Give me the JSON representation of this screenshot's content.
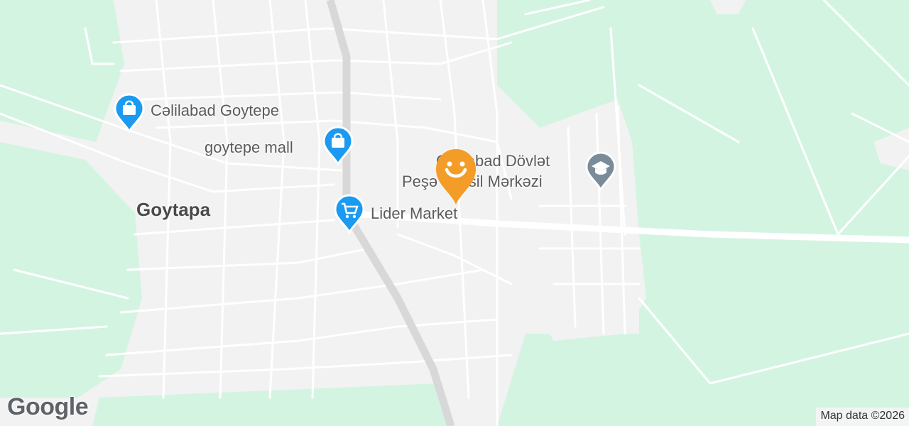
{
  "map": {
    "colors": {
      "land": "#f2f2f2",
      "vegetation": "#d4f4e2",
      "road_minor": "#ffffff",
      "road_highway": "#d8d8d8",
      "poi_shopping": "#1a9af0",
      "poi_education": "#7a8b99",
      "marker": "#f39c27"
    },
    "city_label": "Goytapa",
    "pois": [
      {
        "label": "Cəlilabad Goytepe",
        "icon": "shopping-bag-icon"
      },
      {
        "label": "goytepe mall",
        "icon": "shopping-bag-icon"
      },
      {
        "label": "Lider Market",
        "icon": "shopping-cart-icon"
      },
      {
        "label": "Cəlilabad Dövlət",
        "icon": "graduation-cap-icon"
      },
      {
        "label": "Peşə Təhsil Mərkəzi",
        "icon": "graduation-cap-icon"
      }
    ],
    "marker_icon": "smiley-face-icon",
    "logo": "Google",
    "attribution": "Map data ©2026"
  }
}
